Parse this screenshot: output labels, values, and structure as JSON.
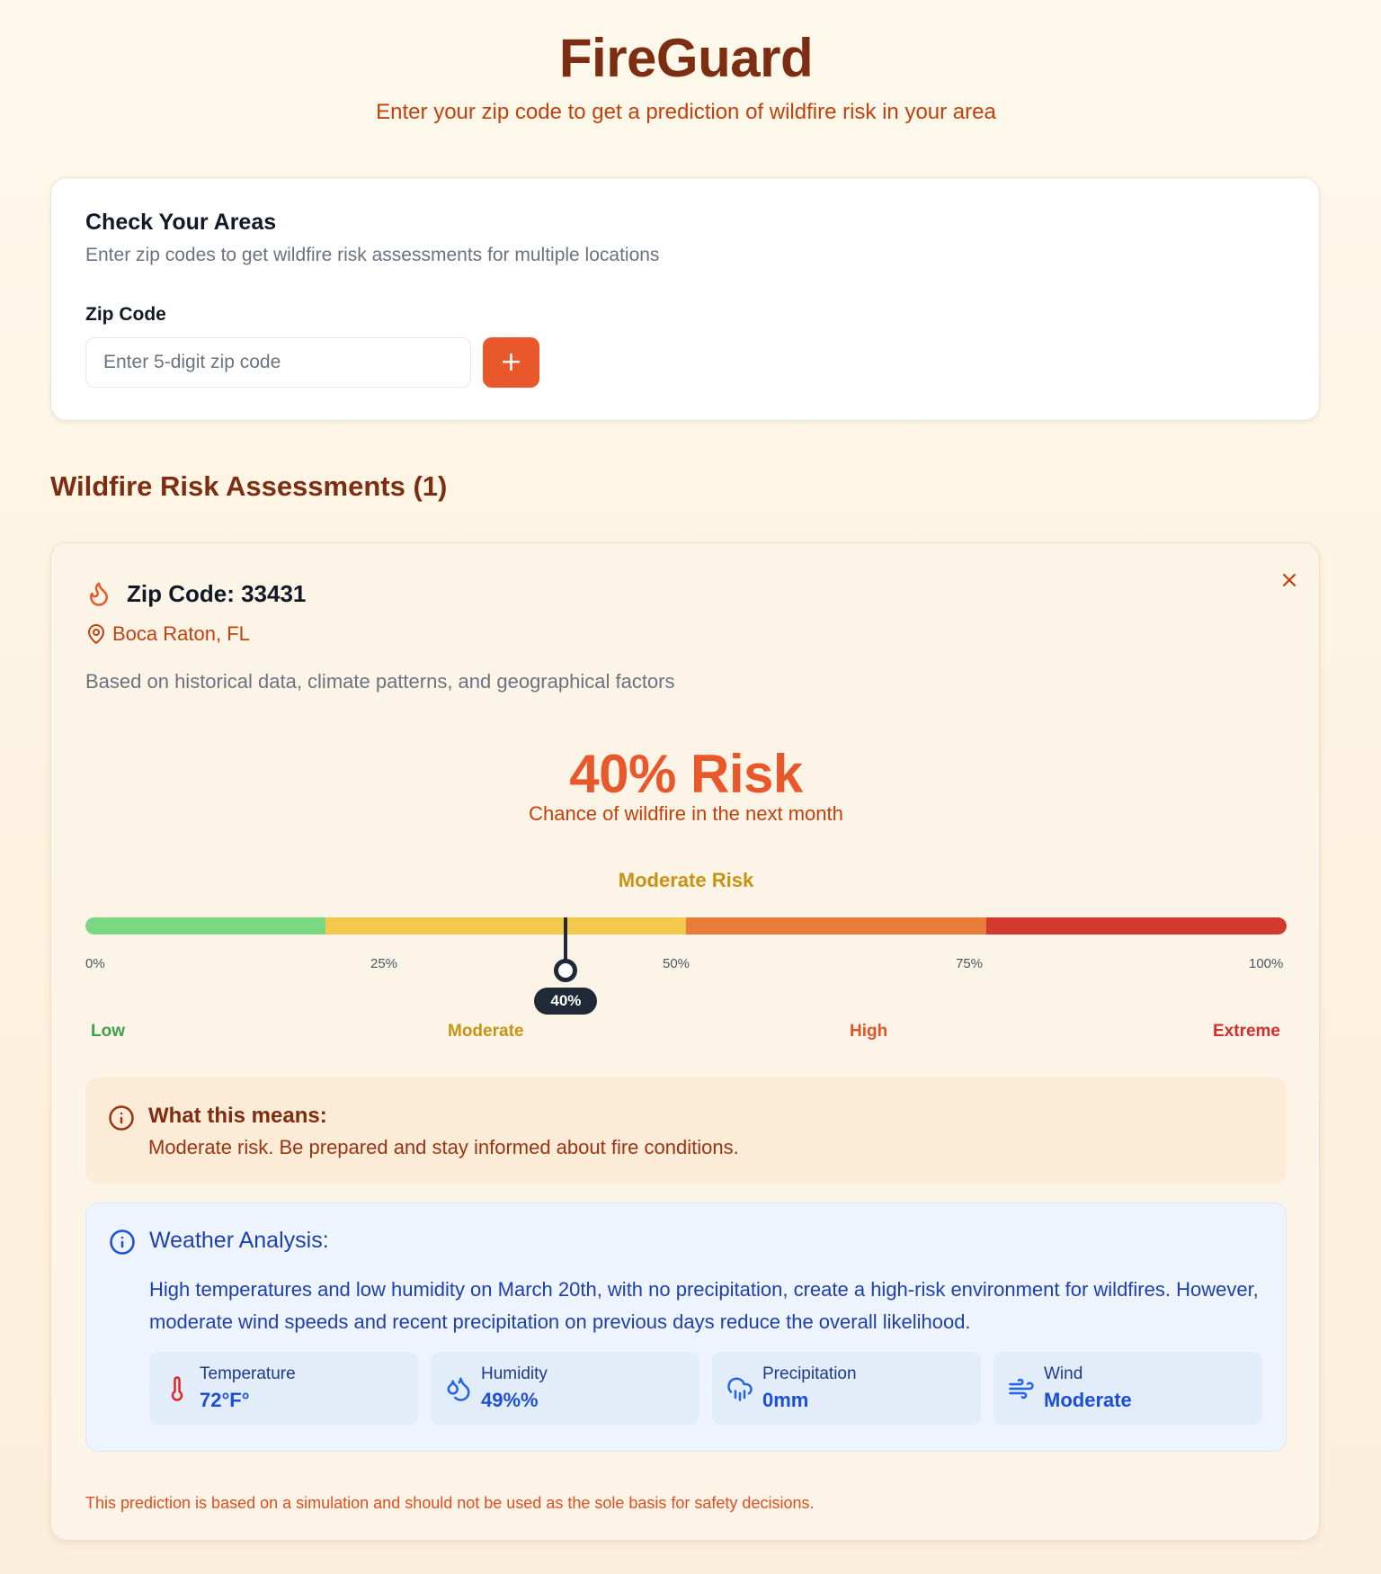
{
  "app": {
    "title": "FireGuard",
    "subtitle": "Enter your zip code to get a prediction of wildfire risk in your area"
  },
  "check_card": {
    "title": "Check Your Areas",
    "description": "Enter zip codes to get wildfire risk assessments for multiple locations",
    "zip_label": "Zip Code",
    "zip_placeholder": "Enter 5-digit zip code",
    "zip_value": "",
    "add_label": "+"
  },
  "assessments": {
    "heading": "Wildfire Risk Assessments (1)",
    "card": {
      "close_label": "×",
      "zip_title": "Zip Code: 33431",
      "location": "Boca Raton, FL",
      "basis": "Based on historical data, climate patterns, and geographical factors",
      "risk_headline": "40% Risk",
      "risk_percent": 40,
      "risk_subtitle": "Chance of wildfire in the next month",
      "risk_level": "Moderate Risk",
      "scale_ticks": [
        "0%",
        "25%",
        "50%",
        "75%",
        "100%"
      ],
      "marker_label": "40%",
      "bands": [
        {
          "label": "Low",
          "color": "#3fa14c"
        },
        {
          "label": "Moderate",
          "color": "#c89213"
        },
        {
          "label": "High",
          "color": "#e0532b"
        },
        {
          "label": "Extreme",
          "color": "#d12f2f"
        }
      ],
      "segment_colors": [
        "#7ad882",
        "#f2c94c",
        "#e87c3a",
        "#d3392e"
      ],
      "means": {
        "title": "What this means:",
        "text": "Moderate risk. Be prepared and stay informed about fire conditions."
      },
      "weather": {
        "title": "Weather Analysis:",
        "text": "High temperatures and low humidity on March 20th, with no precipitation, create a high-risk environment for wildfires. However, moderate wind speeds and recent precipitation on previous days reduce the overall likelihood.",
        "metrics": [
          {
            "label": "Temperature",
            "value": "72°F°",
            "icon": "thermometer-icon"
          },
          {
            "label": "Humidity",
            "value": "49%%",
            "icon": "droplets-icon"
          },
          {
            "label": "Precipitation",
            "value": "0mm",
            "icon": "cloud-rain-icon"
          },
          {
            "label": "Wind",
            "value": "Moderate",
            "icon": "wind-icon"
          }
        ]
      },
      "disclaimer": "This prediction is based on a simulation and should not be used as the sole basis for safety decisions."
    }
  },
  "colors": {
    "brand_dark": "#7c2d12",
    "accent_orange": "#e8582a",
    "weather_blue": "#1e40af"
  }
}
